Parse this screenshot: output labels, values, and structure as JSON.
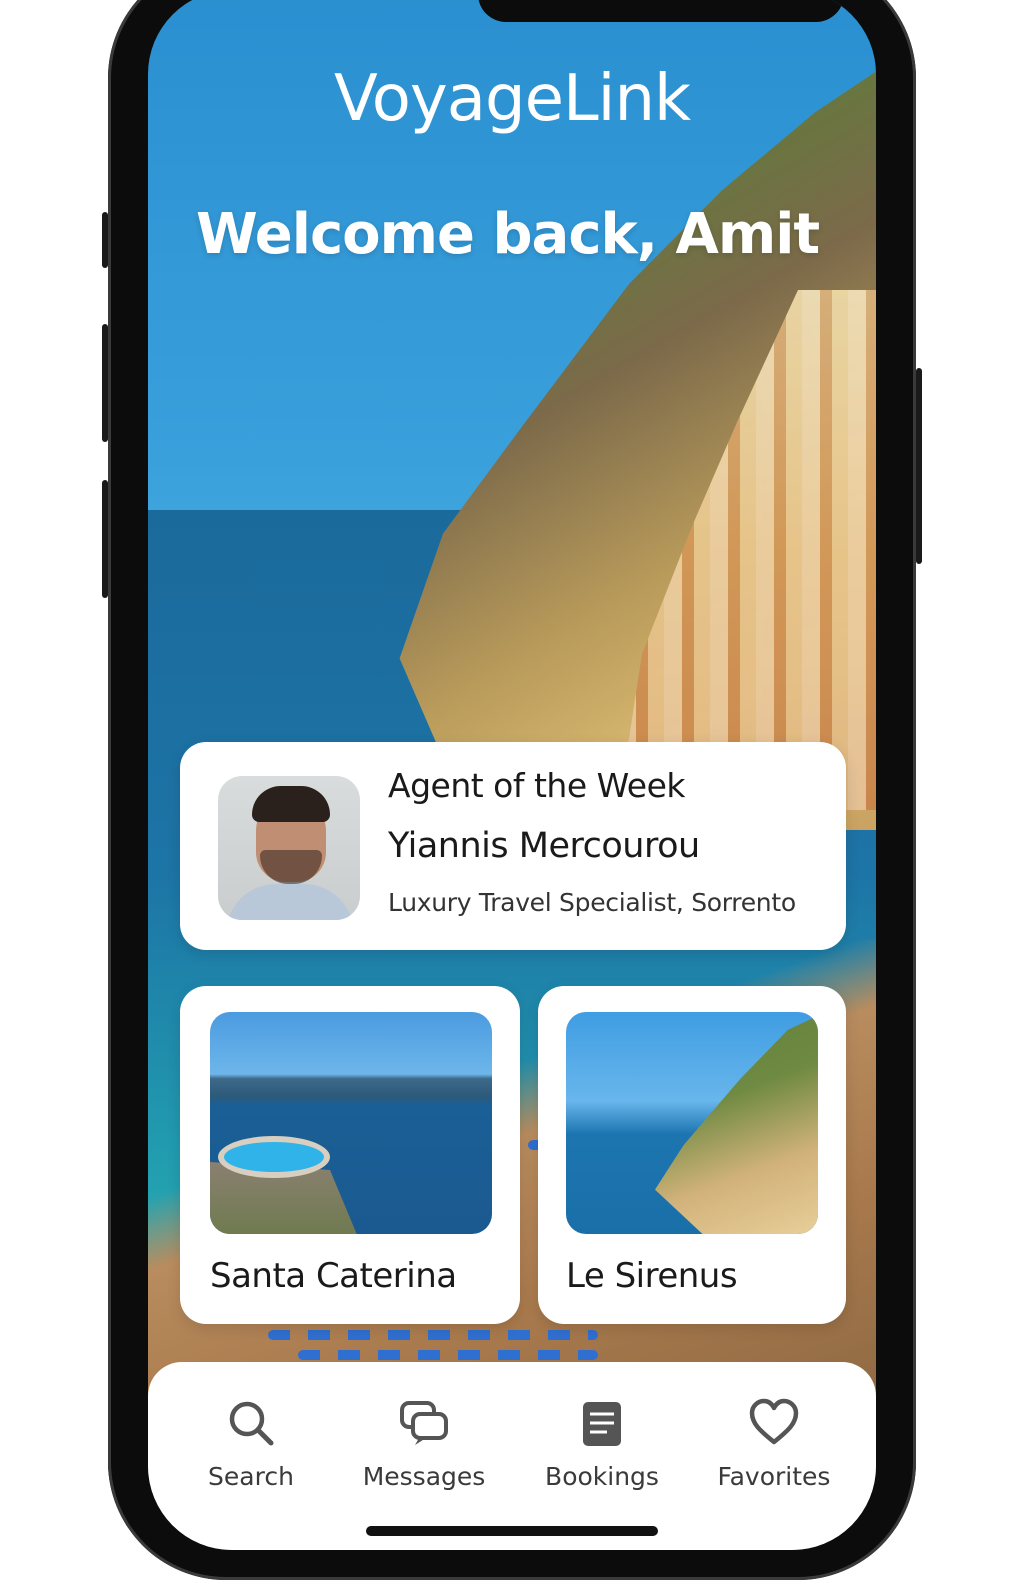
{
  "app": {
    "title": "VoyageLink",
    "greeting": "Welcome back, Amit"
  },
  "agent_card": {
    "label": "Agent of the Week",
    "name": "Yiannis Mercourou",
    "role": "Luxury Travel Specialist, Sorrento"
  },
  "destinations": [
    {
      "name": "Santa Caterina"
    },
    {
      "name": "Le Sirenus"
    }
  ],
  "tab_bar": {
    "items": [
      {
        "label": "Search",
        "icon": "search-icon"
      },
      {
        "label": "Messages",
        "icon": "messages-icon"
      },
      {
        "label": "Bookings",
        "icon": "bookings-icon"
      },
      {
        "label": "Favorites",
        "icon": "heart-icon"
      }
    ]
  },
  "colors": {
    "text_dark": "#1a1a1a",
    "icon_gray": "#555555",
    "card_bg": "#ffffff"
  }
}
